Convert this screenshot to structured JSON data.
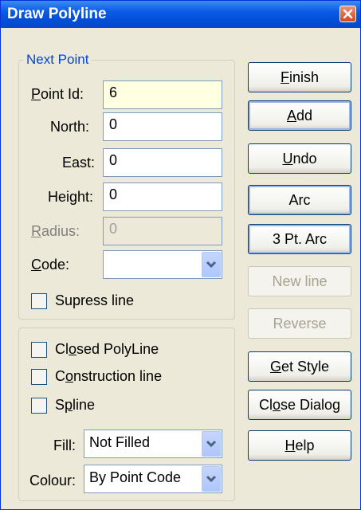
{
  "window": {
    "title": "Draw Polyline"
  },
  "next_point": {
    "legend": "Next Point",
    "point_id": {
      "label_first": "P",
      "label_rest": "oint Id:",
      "value": "6"
    },
    "north": {
      "label": "North:",
      "value": "0"
    },
    "east": {
      "label": "East:",
      "value": "0"
    },
    "height": {
      "label": "Height:",
      "value": "0"
    },
    "radius": {
      "label_first": "R",
      "label_rest": "adius:",
      "value": "0"
    },
    "code": {
      "label_first": "C",
      "label_rest": "ode:",
      "value": ""
    },
    "supress_line": {
      "label": "Supress line"
    }
  },
  "options": {
    "closed_polyline": {
      "label_first": "Cl",
      "label_mid": "o",
      "label_rest": "sed PolyLine"
    },
    "construction_line": {
      "label_first": "C",
      "label_mid": "o",
      "label_rest": "nstruction line"
    },
    "spline": {
      "label_first": "S",
      "label_mid": "p",
      "label_rest": "line"
    },
    "fill": {
      "label": "Fill:",
      "value": "Not Filled"
    },
    "colour": {
      "label": "Colour:",
      "value": "By Point Code"
    }
  },
  "buttons": {
    "finish": {
      "first": "F",
      "rest": "inish"
    },
    "add": {
      "first": "A",
      "rest": "dd"
    },
    "undo": {
      "first": "U",
      "rest": "ndo"
    },
    "arc": "Arc",
    "three_pt_arc": "3 Pt. Arc",
    "new_line": "New line",
    "reverse": "Reverse",
    "get_style": {
      "first": "G",
      "rest": "et Style"
    },
    "close_dialog": {
      "pre": "Cl",
      "u": "o",
      "rest": "se Dialog"
    },
    "help": {
      "first": "H",
      "rest": "elp"
    }
  },
  "colors": {
    "title_bar": "#0b5ae6",
    "accent": "#0046d5",
    "face": "#ece9d8"
  }
}
